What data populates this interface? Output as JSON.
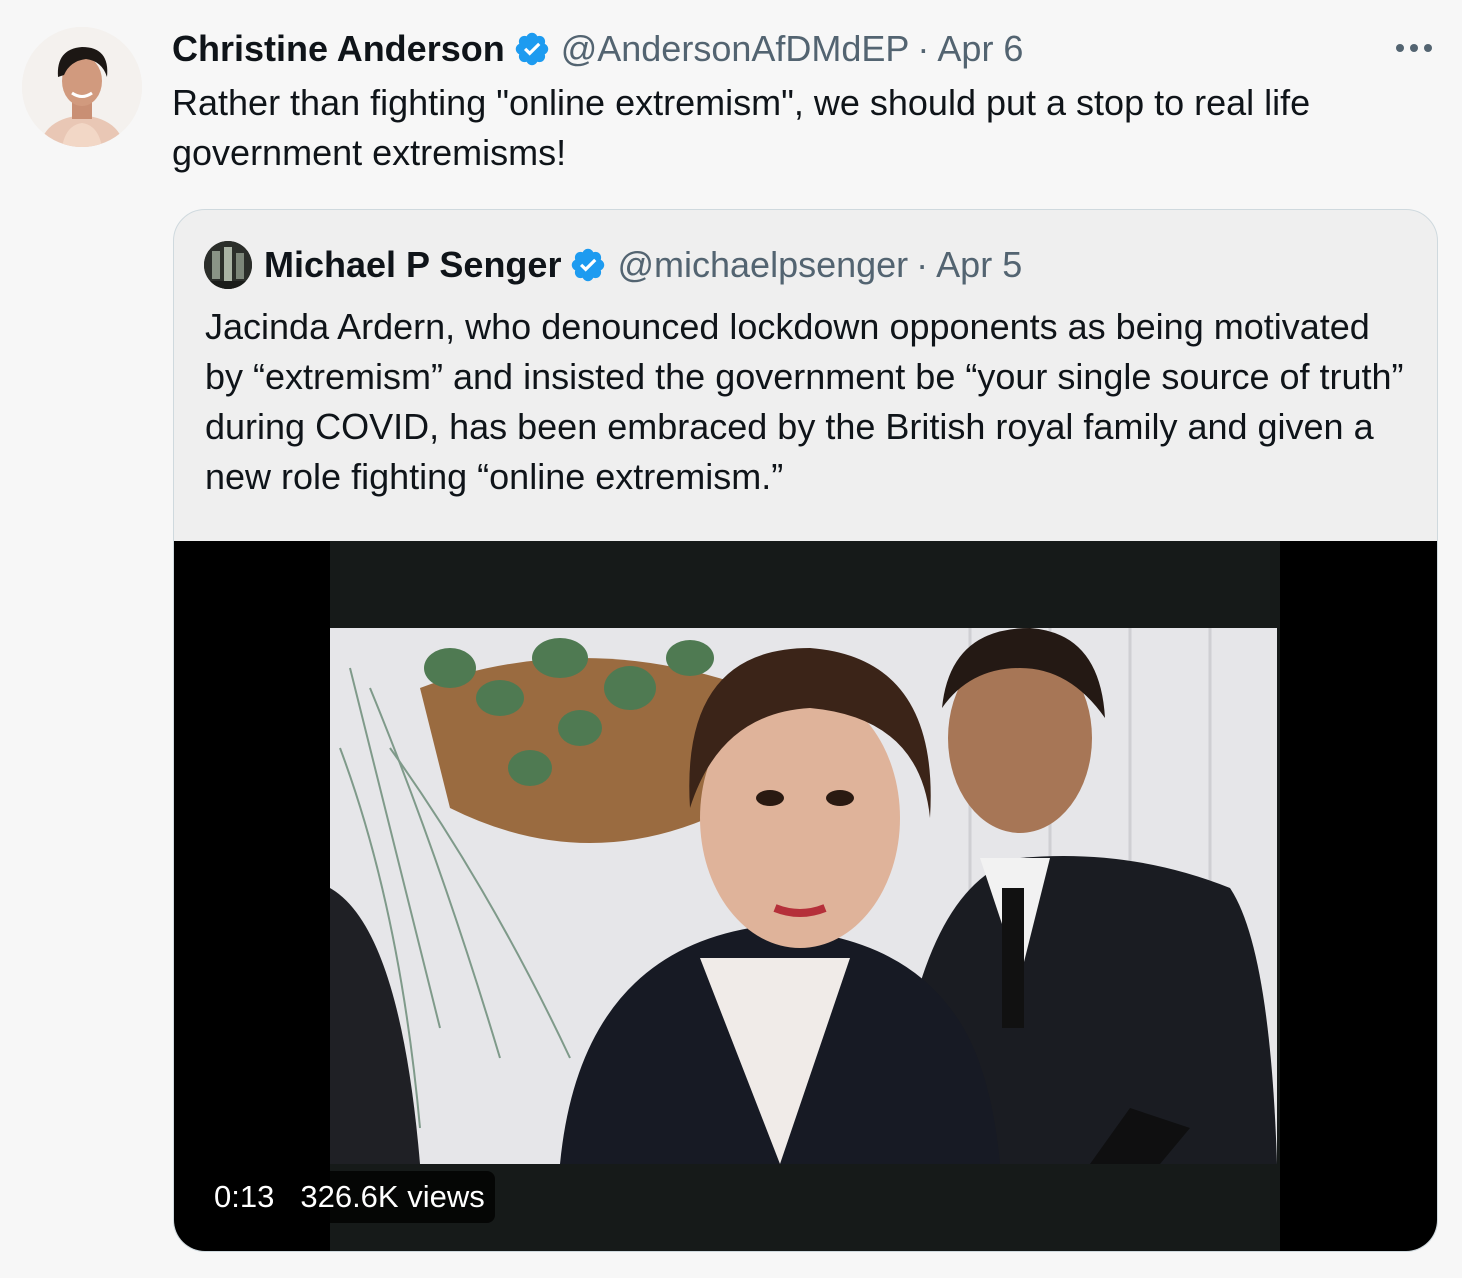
{
  "tweet": {
    "author": {
      "name": "Christine Anderson",
      "handle": "@AndersonAfDMdEP",
      "verified": true
    },
    "separator": "·",
    "date": "Apr 6",
    "text": "Rather than fighting \"online extremism\", we should put a stop to real life government extremisms!",
    "more_icon": "more-horizontal-icon"
  },
  "quoted_tweet": {
    "author": {
      "name": "Michael P Senger",
      "handle": "@michaelpsenger",
      "verified": true
    },
    "separator": "·",
    "date": "Apr 5",
    "text": "Jacinda Ardern, who denounced lockdown opponents as being motivated by “extremism” and insisted the government be “your single source of truth” during COVID, has been embraced by the British royal family and given a new role fighting “online extremism.”",
    "video": {
      "duration": "0:13",
      "views": "326.6K views"
    }
  },
  "colors": {
    "background": "#f7f7f7",
    "text": "#0f1419",
    "secondary_text": "#536471",
    "verified_badge": "#1d9bf0",
    "border": "#cfd9de",
    "quote_background": "#efefef"
  }
}
